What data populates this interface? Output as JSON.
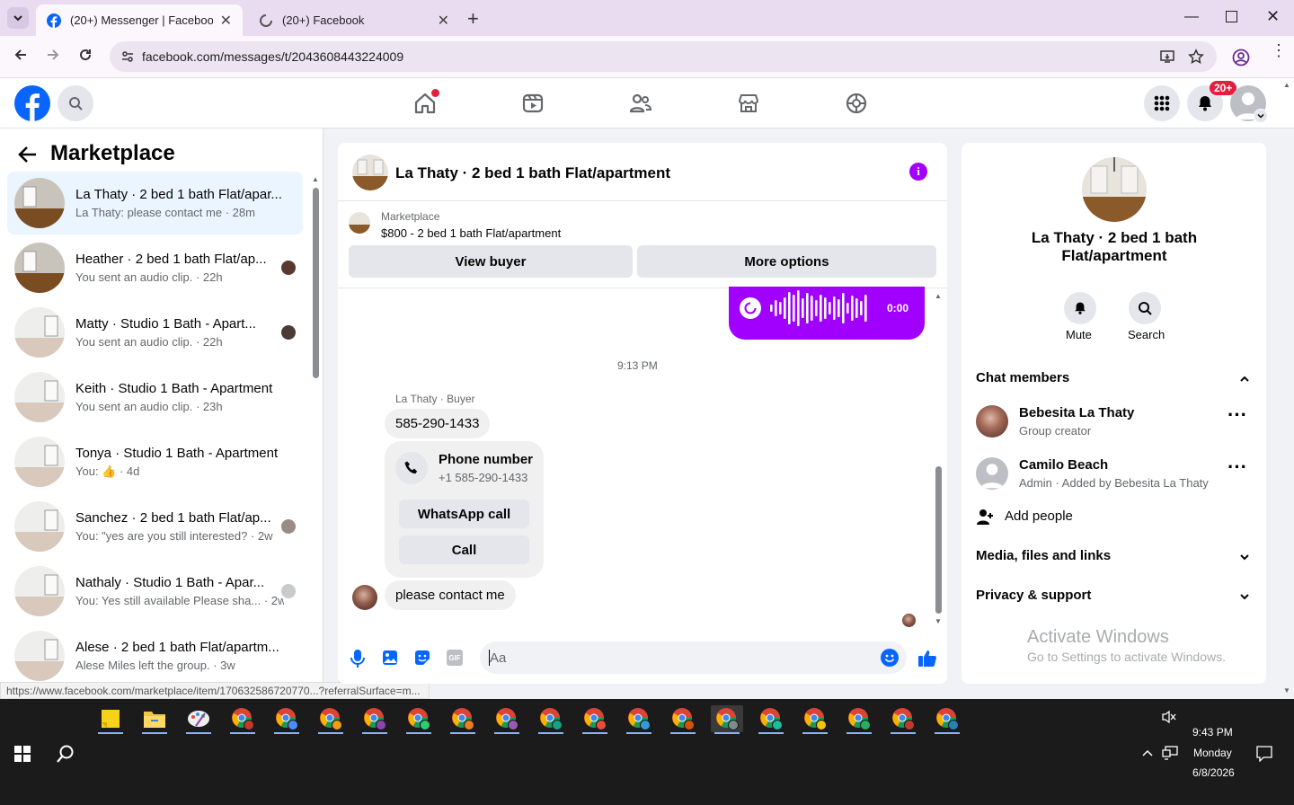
{
  "browser": {
    "tabs": [
      {
        "title": "(20+) Messenger | Facebook",
        "active": true
      },
      {
        "title": "(20+) Facebook",
        "active": false
      }
    ],
    "url": "facebook.com/messages/t/2043608443224009",
    "status_url": "https://www.facebook.com/marketplace/item/170632586720770...?referralSurface=m..."
  },
  "header": {
    "notification_badge": "20+"
  },
  "sidebar": {
    "title": "Marketplace",
    "conversations": [
      {
        "name": "La Thaty · 2 bed 1 bath Flat/apar...",
        "preview": "La Thaty: please contact me · 28m",
        "selected": true
      },
      {
        "name": "Heather · 2 bed 1 bath Flat/ap...",
        "preview": "You sent an audio clip. · 22h"
      },
      {
        "name": "Matty · Studio 1 Bath - Apart...",
        "preview": "You sent an audio clip. · 22h"
      },
      {
        "name": "Keith · Studio 1 Bath - Apartment",
        "preview": "You sent an audio clip. · 23h"
      },
      {
        "name": "Tonya · Studio 1 Bath - Apartment",
        "preview": "You: 👍 · 4d"
      },
      {
        "name": "Sanchez · 2 bed 1 bath Flat/ap...",
        "preview": "You: \"yes are you still interested? · 2w"
      },
      {
        "name": "Nathaly · Studio 1 Bath - Apar...",
        "preview": "You: Yes still available Please sha... · 2w"
      },
      {
        "name": "Alese · 2 bed 1 bath Flat/apartm...",
        "preview": "Alese Miles left the group. · 3w"
      }
    ]
  },
  "chat": {
    "title": "La Thaty · 2 bed 1 bath Flat/apartment",
    "listing_source": "Marketplace",
    "listing": "$800 - 2 bed 1 bath Flat/apartment",
    "view_buyer": "View buyer",
    "more_options": "More options",
    "audio_time": "0:00",
    "timestamp": "9:13 PM",
    "sender_label": "La Thaty · Buyer",
    "phone_message": "585-290-1433",
    "phone_card_title": "Phone number",
    "phone_card_number": "+1 585-290-1433",
    "whatsapp_call": "WhatsApp call",
    "call": "Call",
    "last_message": "please contact me",
    "composer_placeholder": "Aa"
  },
  "details": {
    "name": "La Thaty · 2 bed 1 bath Flat/apartment",
    "mute": "Mute",
    "search": "Search",
    "chat_members": "Chat members",
    "members": [
      {
        "name": "Bebesita La Thaty",
        "role": "Group creator"
      },
      {
        "name": "Camilo Beach",
        "role": "Admin · Added by Bebesita La Thaty"
      }
    ],
    "add_people": "Add people",
    "media": "Media, files and links",
    "privacy": "Privacy & support",
    "watermark_title": "Activate Windows",
    "watermark_sub": "Go to Settings to activate Windows."
  },
  "taskbar": {
    "time": "9:43 PM",
    "day": "Monday",
    "date": "6/8/2026"
  },
  "colors": {
    "fb_blue": "#0866ff",
    "messenger_purple": "#a100ff",
    "tab_bar": "#e9dcf1"
  }
}
